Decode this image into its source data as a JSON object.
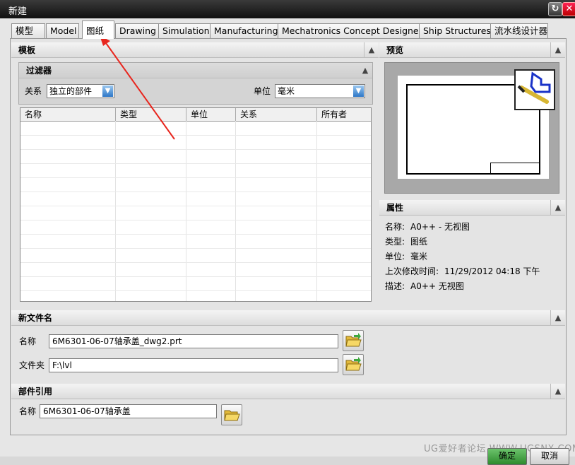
{
  "window": {
    "title": "新建"
  },
  "tabs": [
    {
      "label": "模型",
      "active": false
    },
    {
      "label": "Model",
      "active": false
    },
    {
      "label": "图纸",
      "active": true
    },
    {
      "label": "Drawing",
      "active": false
    },
    {
      "label": "Simulation",
      "active": false
    },
    {
      "label": "Manufacturing",
      "active": false
    },
    {
      "label": "Mechatronics Concept Designer",
      "active": false
    },
    {
      "label": "Ship Structures",
      "active": false
    },
    {
      "label": "流水线设计器",
      "active": false
    }
  ],
  "templates": {
    "title": "模板",
    "filter": {
      "title": "过滤器",
      "relation_label": "关系",
      "relation_value": "独立的部件",
      "unit_label": "单位",
      "unit_value": "毫米"
    },
    "columns": [
      "名称",
      "类型",
      "单位",
      "关系",
      "所有者"
    ]
  },
  "preview": {
    "title": "预览"
  },
  "properties": {
    "title": "属性",
    "rows": [
      {
        "label": "名称:",
        "value": "A0++ - 无视图"
      },
      {
        "label": "类型:",
        "value": "图纸"
      },
      {
        "label": "单位:",
        "value": "毫米"
      },
      {
        "label": "上次修改时间:",
        "value": "11/29/2012 04:18 下午"
      },
      {
        "label": "描述:",
        "value": "A0++ 无视图"
      }
    ]
  },
  "new_file": {
    "title": "新文件名",
    "name_label": "名称",
    "name_value": "6M6301-06-07轴承盖_dwg2.prt",
    "folder_label": "文件夹",
    "folder_value": "F:\\lvl"
  },
  "part_reference": {
    "title": "部件引用",
    "name_label": "名称",
    "name_value": "6M6301-06-07轴承盖"
  },
  "footer": {
    "watermark": "UG爱好者论坛 WWW.UGSNX.COM",
    "ok_label": "确定",
    "cancel_label": "取消"
  },
  "colors": {
    "annotation_arrow": "#e8261e",
    "combo_arrow": "#2d77c7"
  },
  "icons": {
    "folder": "folder-open-icon",
    "chevron": "chevron-up-icon"
  }
}
